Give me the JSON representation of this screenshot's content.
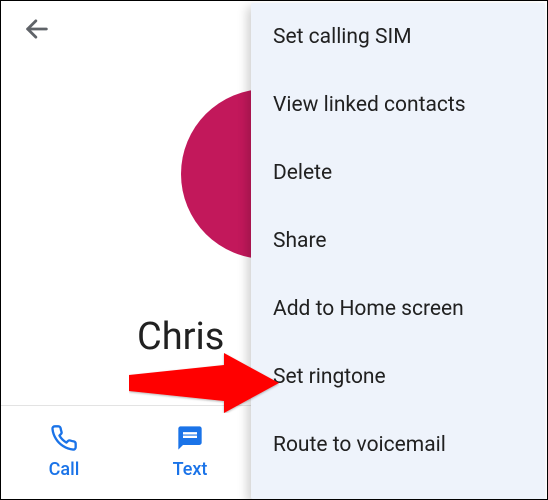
{
  "header": {
    "back_icon": "arrow-back"
  },
  "contact": {
    "name": "Chris",
    "avatar_color": "#c2185b"
  },
  "actions": {
    "call_label": "Call",
    "text_label": "Text"
  },
  "menu": {
    "items": [
      {
        "label": "Set calling SIM"
      },
      {
        "label": "View linked contacts"
      },
      {
        "label": "Delete"
      },
      {
        "label": "Share"
      },
      {
        "label": "Add to Home screen"
      },
      {
        "label": "Set ringtone"
      },
      {
        "label": "Route to voicemail"
      }
    ]
  },
  "annotation": {
    "highlight_item_index": 5
  }
}
